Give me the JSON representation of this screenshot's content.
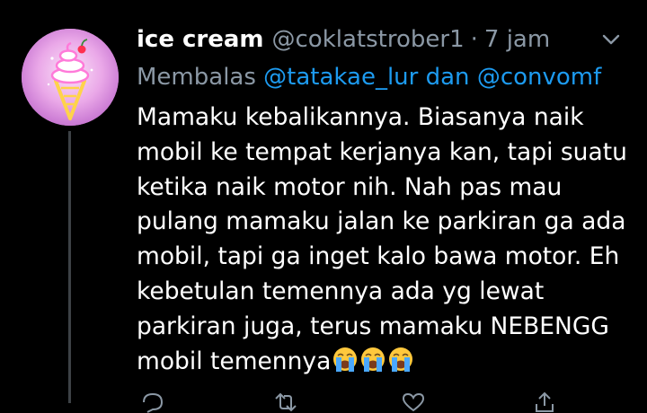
{
  "tweet": {
    "display_name": "ice cream",
    "handle": "@coklatstrober1",
    "separator": "·",
    "time": "7 jam",
    "reply_label": "Membalas",
    "reply_mentions": [
      "@tatakae_lur",
      "@convomf"
    ],
    "reply_joiner": "dan",
    "body_lines": [
      "Mamaku kebalikannya. Biasanya naik",
      "mobil ke tempat kerjanya kan, tapi suatu",
      "ketika naik motor nih. Nah pas mau",
      "pulang mamaku jalan ke parkiran ga ada",
      "mobil, tapi ga inget kalo bawa motor. Eh",
      "kebetulan temennya ada yg lewat",
      "parkiran juga, terus mamaku NEBENGG",
      "mobil temennya"
    ],
    "emoji": [
      "loudly-crying-face",
      "loudly-crying-face",
      "loudly-crying-face"
    ]
  },
  "colors": {
    "background": "#000000",
    "text_primary": "#ffffff",
    "text_secondary": "#8b98a5",
    "link": "#1d9bf0",
    "thread_line": "#3d4246",
    "avatar_bg": "#e39be2"
  },
  "icons": {
    "avatar": "ice-cream-neon-avatar",
    "menu": "chevron-down-icon",
    "actions": [
      "reply-icon",
      "retweet-icon",
      "like-icon",
      "share-icon"
    ]
  }
}
